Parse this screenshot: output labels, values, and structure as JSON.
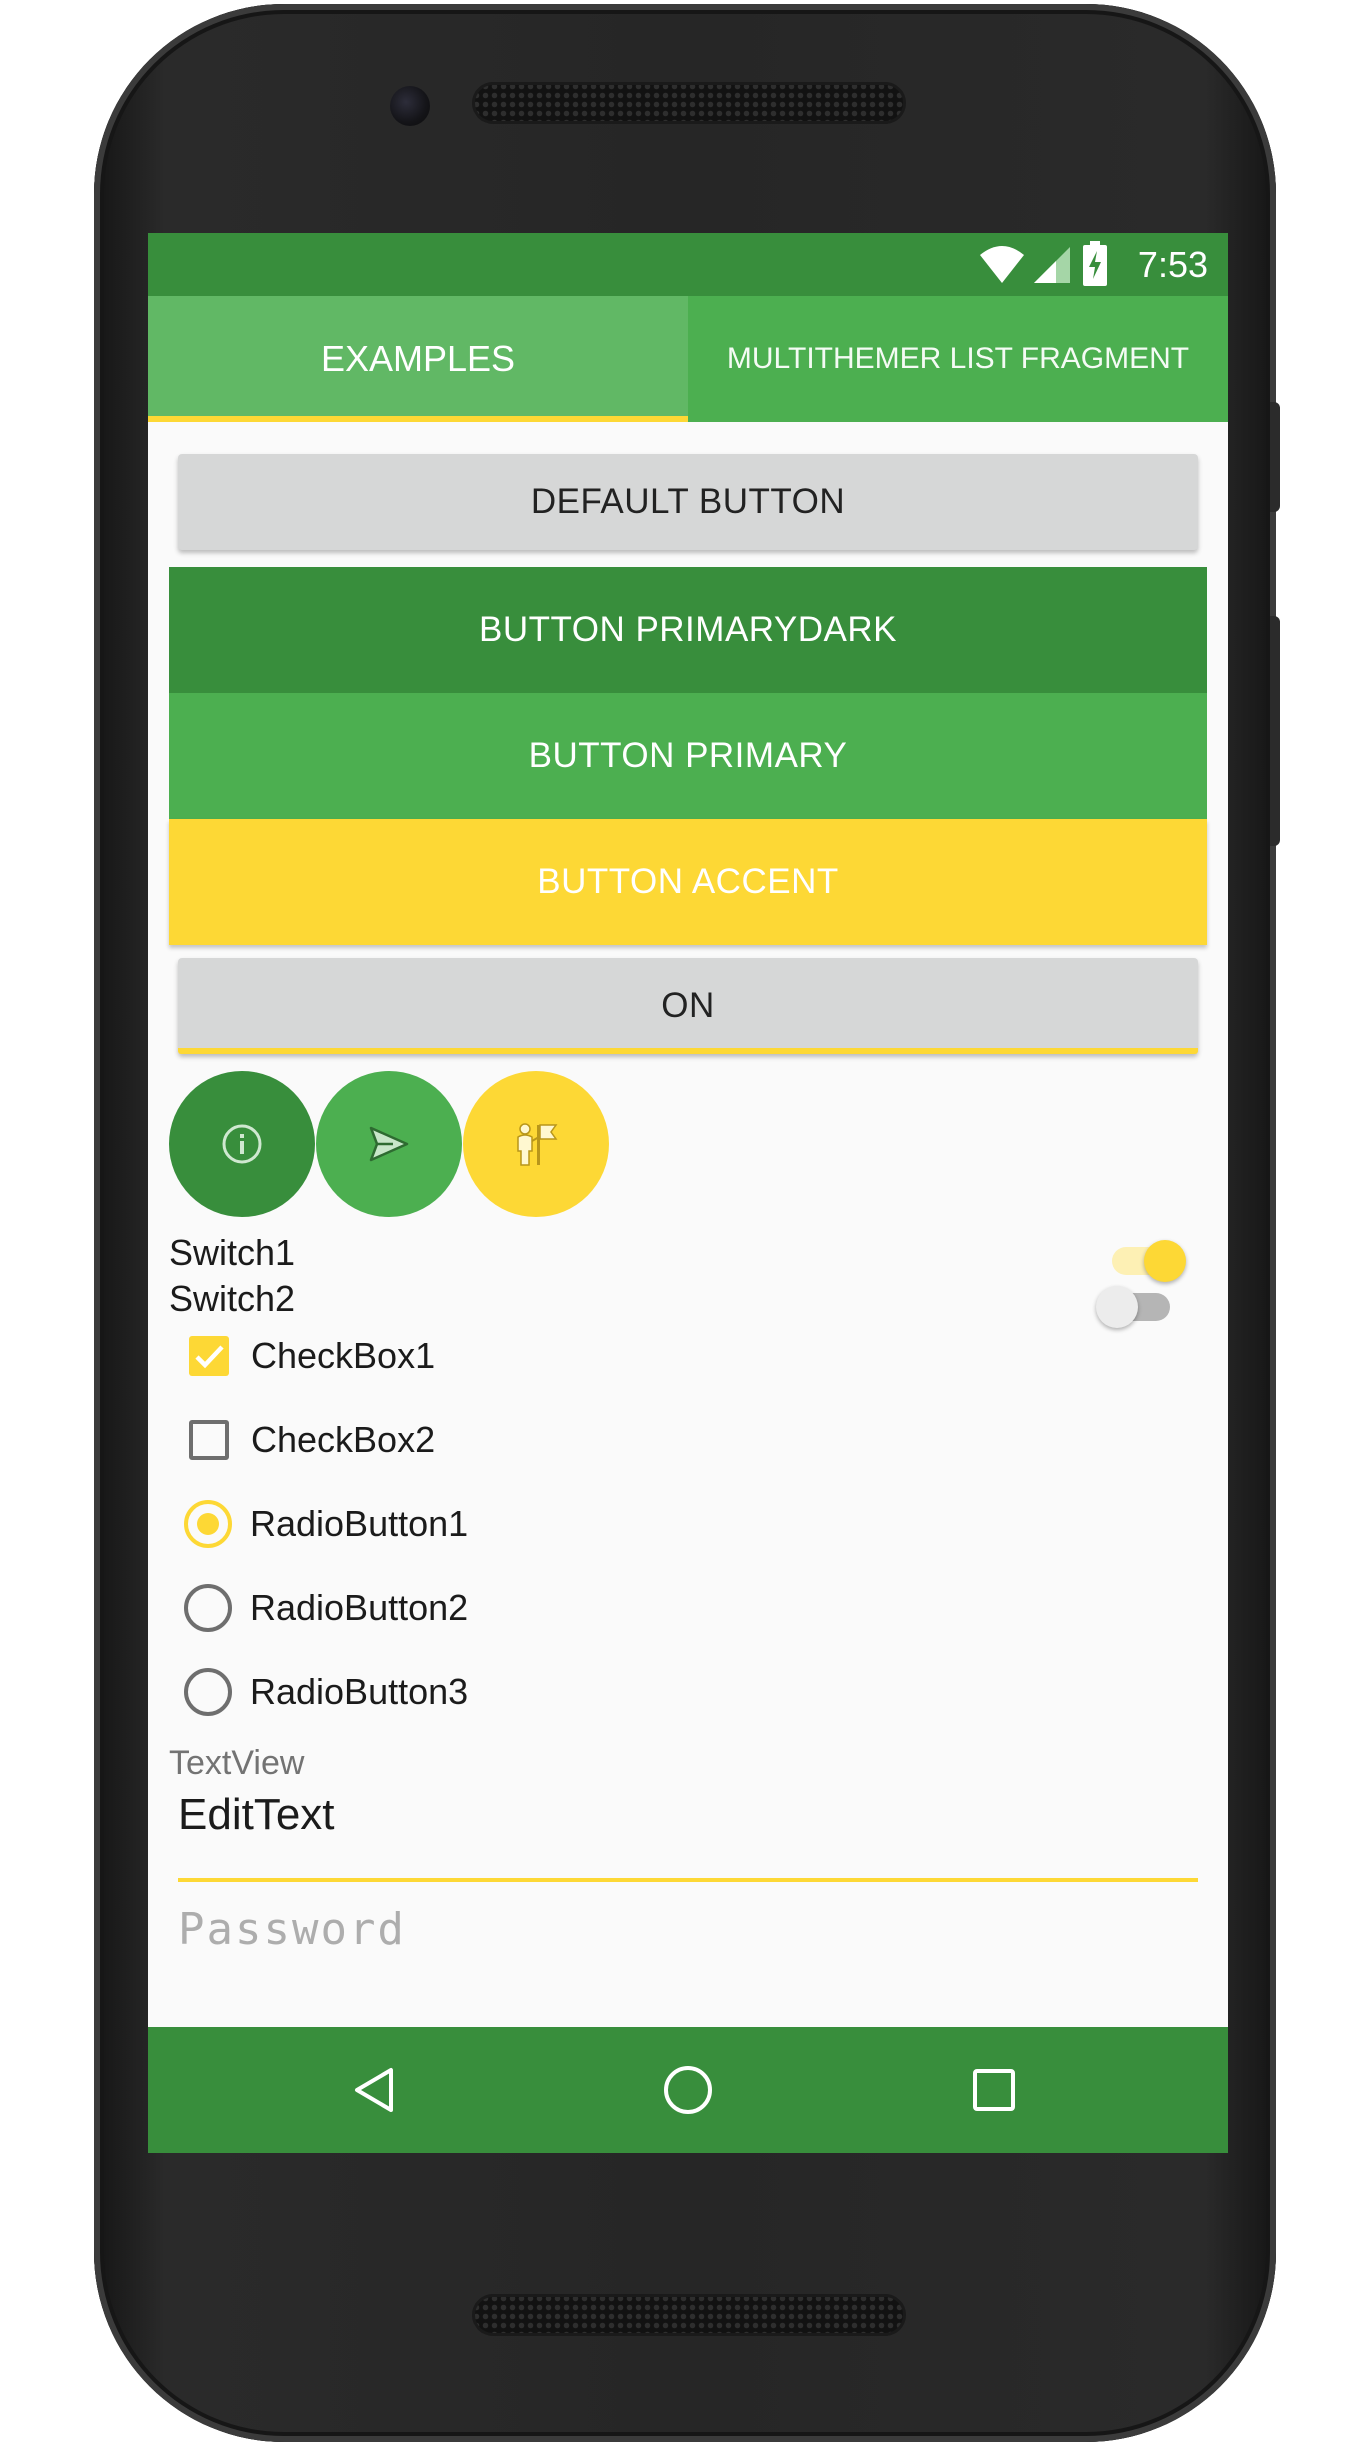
{
  "colors": {
    "primary": "#4caf50",
    "primary_dark": "#388e3c",
    "accent": "#fdd835",
    "button_default": "#d6d7d7",
    "background": "#fafafa"
  },
  "status_bar": {
    "time": "7:53",
    "icons": [
      "wifi-icon",
      "cell-signal-icon",
      "battery-charging-icon"
    ]
  },
  "tabs": [
    {
      "label": "EXAMPLES",
      "selected": true
    },
    {
      "label": "MULTITHEMER LIST FRAGMENT",
      "selected": false
    }
  ],
  "buttons": {
    "default": "DEFAULT BUTTON",
    "primary_dark": "BUTTON PRIMARYDARK",
    "primary": "BUTTON PRIMARY",
    "accent": "BUTTON ACCENT",
    "toggle": "ON"
  },
  "fabs": [
    {
      "icon": "info-icon",
      "color": "primary_dark"
    },
    {
      "icon": "send-icon",
      "color": "primary"
    },
    {
      "icon": "tour-flag-icon",
      "color": "accent"
    }
  ],
  "switches": [
    {
      "label": "Switch1",
      "checked": true
    },
    {
      "label": "Switch2",
      "checked": false
    }
  ],
  "checkboxes": [
    {
      "label": "CheckBox1",
      "checked": true
    },
    {
      "label": "CheckBox2",
      "checked": false
    }
  ],
  "radios": [
    {
      "label": "RadioButton1",
      "checked": true
    },
    {
      "label": "RadioButton2",
      "checked": false
    },
    {
      "label": "RadioButton3",
      "checked": false
    }
  ],
  "textview": "TextView",
  "edittext": {
    "value": "EditText"
  },
  "password": {
    "placeholder": "Password"
  },
  "nav": [
    "back-icon",
    "home-icon",
    "recents-icon"
  ]
}
